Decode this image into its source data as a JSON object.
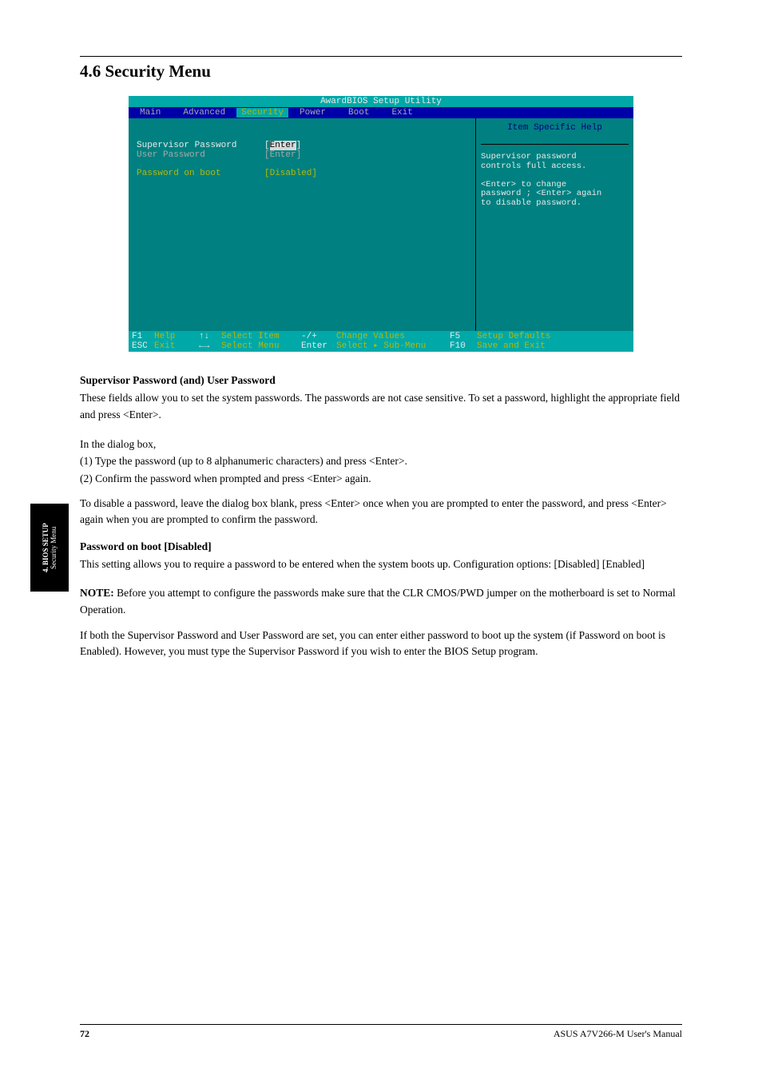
{
  "section": {
    "number": "4.6",
    "title": "Security Menu"
  },
  "bios": {
    "title": "AwardBIOS Setup Utility",
    "menu": [
      "Main",
      "Advanced",
      "Security",
      "Power",
      "Boot",
      "Exit"
    ],
    "active_menu_index": 2,
    "items": [
      {
        "label": "Supervisor Password",
        "value": "[Enter]",
        "selected": true,
        "value_style": "white"
      },
      {
        "label": "User Password",
        "value": "[Enter]",
        "selected": false,
        "value_style": "grey"
      },
      {
        "label": "",
        "value": ""
      },
      {
        "label": "Password on boot",
        "value": "[Disabled]",
        "selected": false,
        "value_style": "yellow"
      }
    ],
    "help_title": "Item Specific Help",
    "help_text": "Supervisor password controls full access.\n\n<Enter> to change password ; <Enter> again to disable password.",
    "footer": {
      "row1": [
        {
          "key": "F1",
          "label": "Help"
        },
        {
          "key": "↑↓",
          "label": "Select Item"
        },
        {
          "key": "-/+",
          "label": "Change Values"
        },
        {
          "key": "F5",
          "label": "Setup Defaults"
        }
      ],
      "row2": [
        {
          "key": "ESC",
          "label": "Exit"
        },
        {
          "key": "←→",
          "label": "Select Menu"
        },
        {
          "key": "Enter",
          "label": "Select ▸ Sub-Menu"
        },
        {
          "key": "F10",
          "label": "Save and Exit"
        }
      ]
    }
  },
  "doc": {
    "field1_title": "Supervisor Password (and) User Password",
    "field1_text": "These fields allow you to set the system passwords. The passwords are not case sensitive. To set a password, highlight the appropriate field and press <Enter>.",
    "field1_steps": "In the dialog box,\n(1) Type the password (up to 8 alphanumeric characters) and press <Enter>.\n(2) Confirm the password when prompted and press <Enter> again.",
    "field1_note": "To disable a password, leave the dialog box blank, press <Enter> once when you are prompted to enter the password, and press <Enter> again when you are prompted to confirm the password.",
    "field2_title": "Password on boot [Disabled]",
    "field2_text": "This setting allows you to require a password to be entered when the system boots up. Configuration options: [Disabled] [Enabled]",
    "note_label": "NOTE:",
    "note_text": "Before you attempt to configure the passwords make sure that the CLR CMOS/PWD jumper on the motherboard is set to Normal Operation.",
    "note2": "If both the Supervisor Password and User Password are set, you can enter either password to boot up the system (if Password on boot is Enabled). However, you must type the Supervisor Password if you wish to enter the BIOS Setup program."
  },
  "sidetab": {
    "line1": "4. BIOS SETUP",
    "line2": "Security Menu"
  },
  "footer": {
    "page": "72",
    "manual": "ASUS A7V266-M User's Manual"
  }
}
